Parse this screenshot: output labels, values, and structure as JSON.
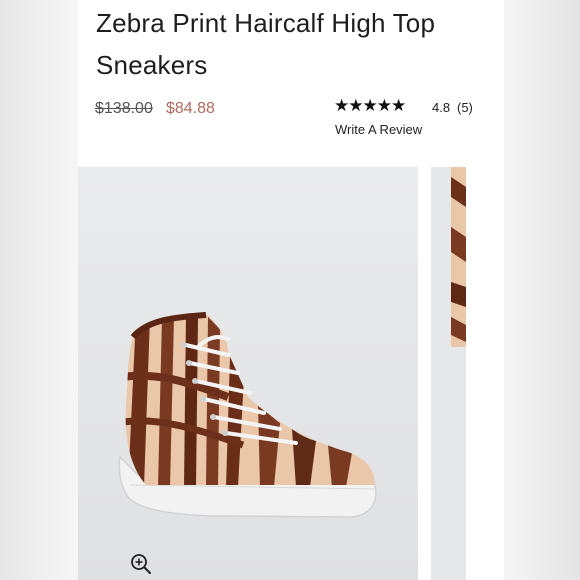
{
  "product": {
    "title": "Zebra Print Haircalf High Top Sneakers",
    "price_original": "$138.00",
    "price_sale": "$84.88"
  },
  "reviews": {
    "stars": "★★★★★",
    "rating": "4.8",
    "count": "(5)",
    "write_review_label": "Write A Review"
  },
  "icons": {
    "zoom": "zoom-in-icon"
  },
  "colors": {
    "sale_price": "#b06a5c",
    "text": "#1e1e1e"
  }
}
